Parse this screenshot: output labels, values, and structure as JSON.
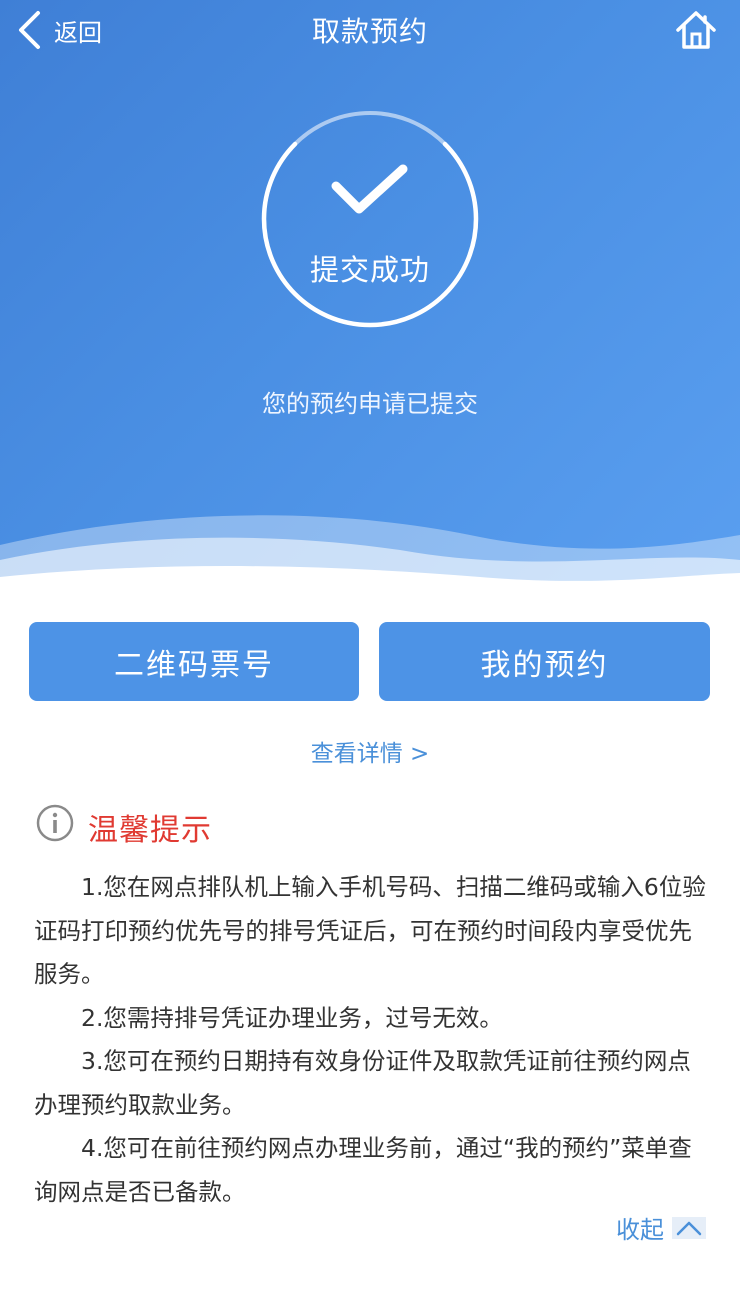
{
  "header": {
    "back_label": "返回",
    "title": "取款预约"
  },
  "status": {
    "title": "提交成功",
    "message": "您的预约申请已提交"
  },
  "actions": {
    "qr_ticket": "二维码票号",
    "my_appointment": "我的预约",
    "details_link": "查看详情 >"
  },
  "tips": {
    "title": "温馨提示",
    "items": [
      "1.您在网点排队机上输入手机号码、扫描二维码或输入6位验证码打印预约优先号的排号凭证后，可在预约时间段内享受优先服务。",
      "2.您需持排号凭证办理业务，过号无效。",
      "3.您可在预约日期持有效身份证件及取款凭证前往预约网点办理预约取款业务。",
      "4.您可在前往预约网点办理业务前，通过“我的预约”菜单查询网点是否已备款。"
    ],
    "collapse_label": "收起"
  },
  "icons": {
    "back": "chevron-left-icon",
    "home": "home-icon",
    "success": "checkmark-icon",
    "info": "info-circle-icon",
    "collapse": "chevron-up-icon"
  },
  "colors": {
    "primary": "#4d93e6",
    "link": "#4a90d9",
    "warning_title": "#e03a32"
  }
}
